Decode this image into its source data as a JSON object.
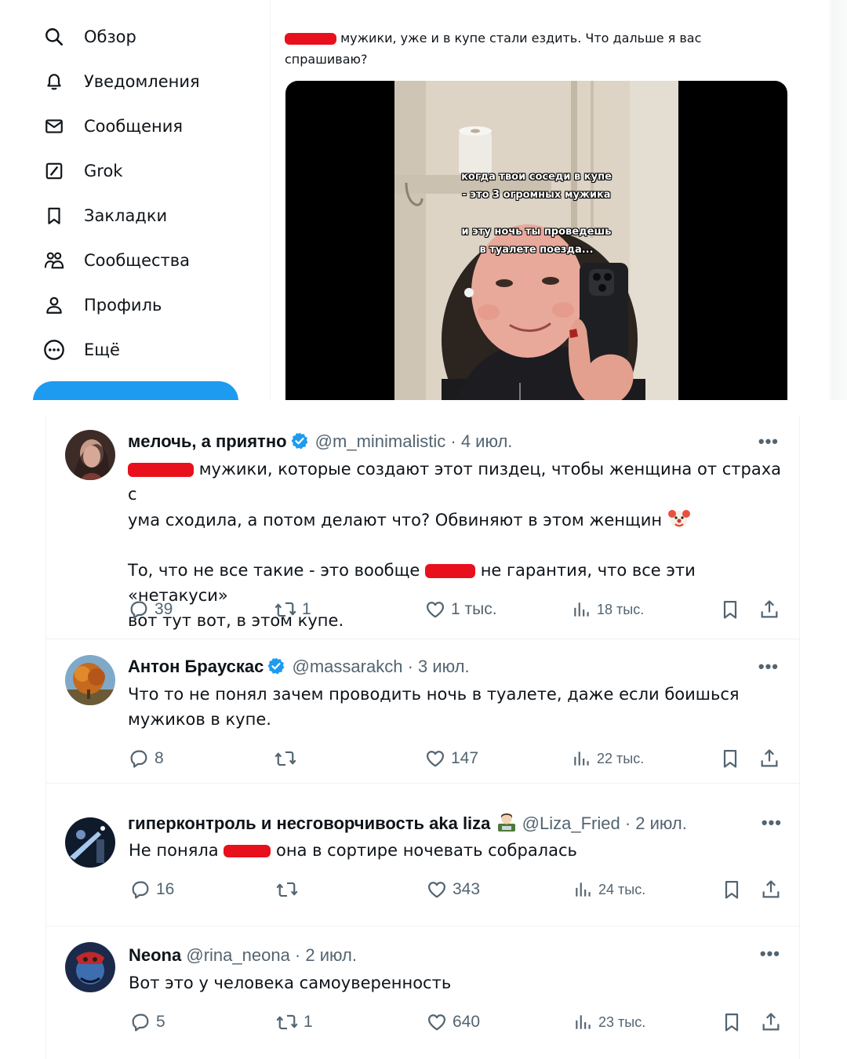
{
  "sidebar": {
    "items": [
      {
        "label": "Обзор",
        "icon": "search-icon"
      },
      {
        "label": "Уведомления",
        "icon": "bell-icon"
      },
      {
        "label": "Сообщения",
        "icon": "envelope-icon"
      },
      {
        "label": "Grok",
        "icon": "grok-icon"
      },
      {
        "label": "Закладки",
        "icon": "bookmark-icon"
      },
      {
        "label": "Сообщества",
        "icon": "communities-icon"
      },
      {
        "label": "Профиль",
        "icon": "person-icon"
      },
      {
        "label": "Ещё",
        "icon": "more-circle-icon"
      }
    ],
    "post_button_color": "#1d9bf0"
  },
  "original_post": {
    "text_line1": "мужики, уже и в купе стали ездить. Что дальше я вас",
    "text_line2": "спрашиваю?",
    "video_overlay": {
      "line1": "когда твои соседи в купе",
      "line2": "- это 3 огромных мужика",
      "line3": "и эту ночь ты проведешь",
      "line4": "в туалете поезда..."
    }
  },
  "replies": [
    {
      "name": "мелочь, а приятно",
      "verified": true,
      "handle": "@m_minimalistic",
      "date": "4 июл.",
      "line1": "мужики, которые создают этот пиздец, чтобы женщина от страха с",
      "line2": "ума сходила, а потом делают что? Обвиняют в этом женщин",
      "line3a": "То, что не все такие - это вообще",
      "line3b": "не гарантия, что все эти «нетакуси»",
      "line4": "вот тут вот, в этом купе.",
      "replies": "39",
      "reposts": "1",
      "likes": "1 тыс.",
      "views": "18 тыс."
    },
    {
      "name": "Антон Браускас",
      "verified": true,
      "handle": "@massarakch",
      "date": "3 июл.",
      "line1": "Что то не понял зачем проводить ночь в туалете, даже если боишься",
      "line2": "мужиков в купе.",
      "replies": "8",
      "reposts": "",
      "likes": "147",
      "views": "22 тыс."
    },
    {
      "name": "гиперконтроль и несговорчивость aka liza",
      "verified": false,
      "handle": "@Liza_Fried",
      "date": "2 июл.",
      "line1a": "Не поняла",
      "line1b": "она в сортире ночевать собралась",
      "replies": "16",
      "reposts": "",
      "likes": "343",
      "views": "24 тыс."
    },
    {
      "name": "Neona",
      "verified": false,
      "handle": "@rina_neona",
      "date": "2 июл.",
      "line1": "Вот это у человека самоуверенность",
      "replies": "5",
      "reposts": "1",
      "likes": "640",
      "views": "23 тыс."
    }
  ],
  "colors": {
    "accent": "#1d9bf0",
    "redaction": "#e8101c",
    "muted_text": "#536471"
  }
}
